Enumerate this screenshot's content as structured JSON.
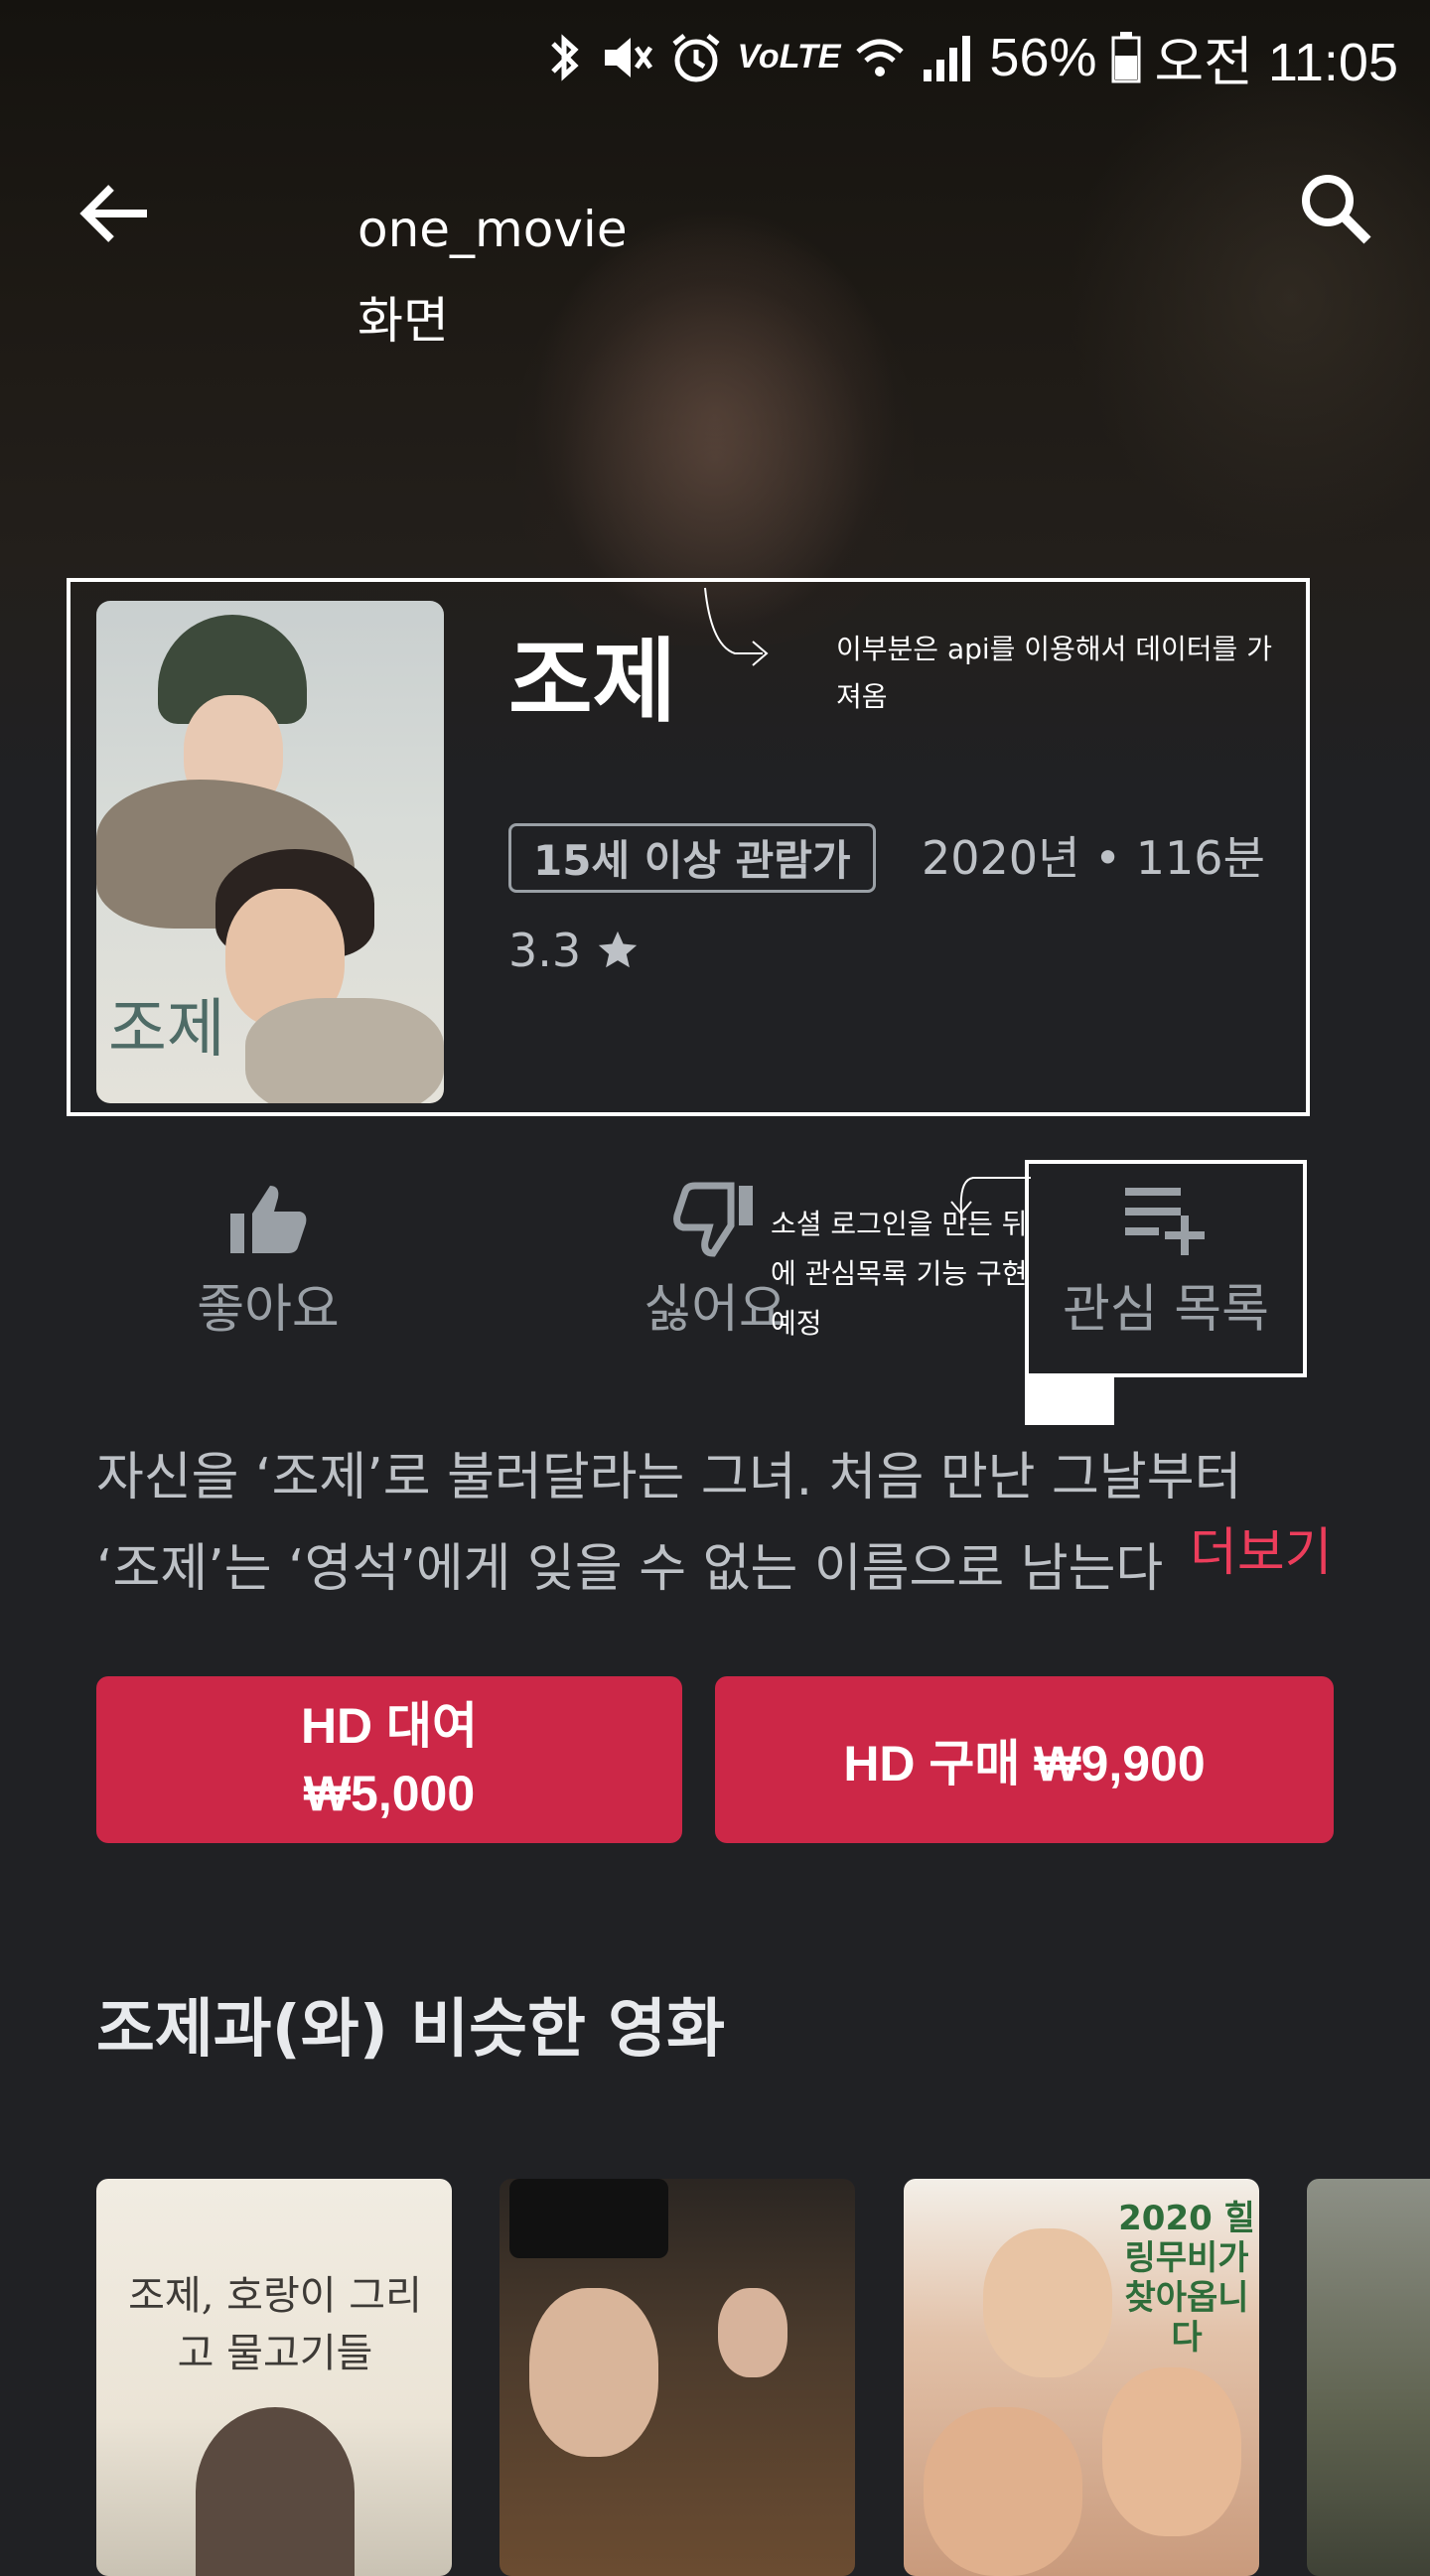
{
  "status_bar": {
    "battery": "56%",
    "time": "오전 11:05",
    "network": "VoLTE"
  },
  "app_bar": {
    "title": "one_movie화면"
  },
  "movie": {
    "title": "조제",
    "poster_text": "조제",
    "rating_badge": "15세 이상 관람가",
    "meta": "2020년 • 116분",
    "score": "3.3"
  },
  "annotations": {
    "api": "이부분은 api를 이용해서 데이터를 가져옴",
    "social": "소셜 로그인을 만든 뒤에 관심목록 기능 구현 예정"
  },
  "actions": {
    "like": {
      "label": "좋아요",
      "icon": "thumb-up-icon"
    },
    "dislike": {
      "label": "싫어요",
      "icon": "thumb-down-icon"
    },
    "wishlist": {
      "label": "관심 목록",
      "icon": "playlist-add-icon"
    }
  },
  "synopsis": {
    "line1": "자신을 ‘조제’로 불러달라는 그녀. 처음 만난 그날부터",
    "line2": "‘조제’는 ‘영석’에게 잊을 수 없는 이름으로 남는다",
    "more": "더보기"
  },
  "purchase": {
    "rent_line1": "HD 대여",
    "rent_line2": "₩5,000",
    "buy": "HD 구매 ₩9,900"
  },
  "similar": {
    "title": "조제과(와) 비슷한 영화",
    "items": [
      {
        "poster_text": "조제, 호랑이 그리고 물고기들"
      },
      {
        "poster_text": ""
      },
      {
        "poster_text": "2020 힐링무비가 찾아옵니다"
      },
      {
        "poster_text": ""
      }
    ]
  },
  "colors": {
    "accent": "#cc2747",
    "more_link": "#ec3d5b",
    "background": "#202124"
  }
}
